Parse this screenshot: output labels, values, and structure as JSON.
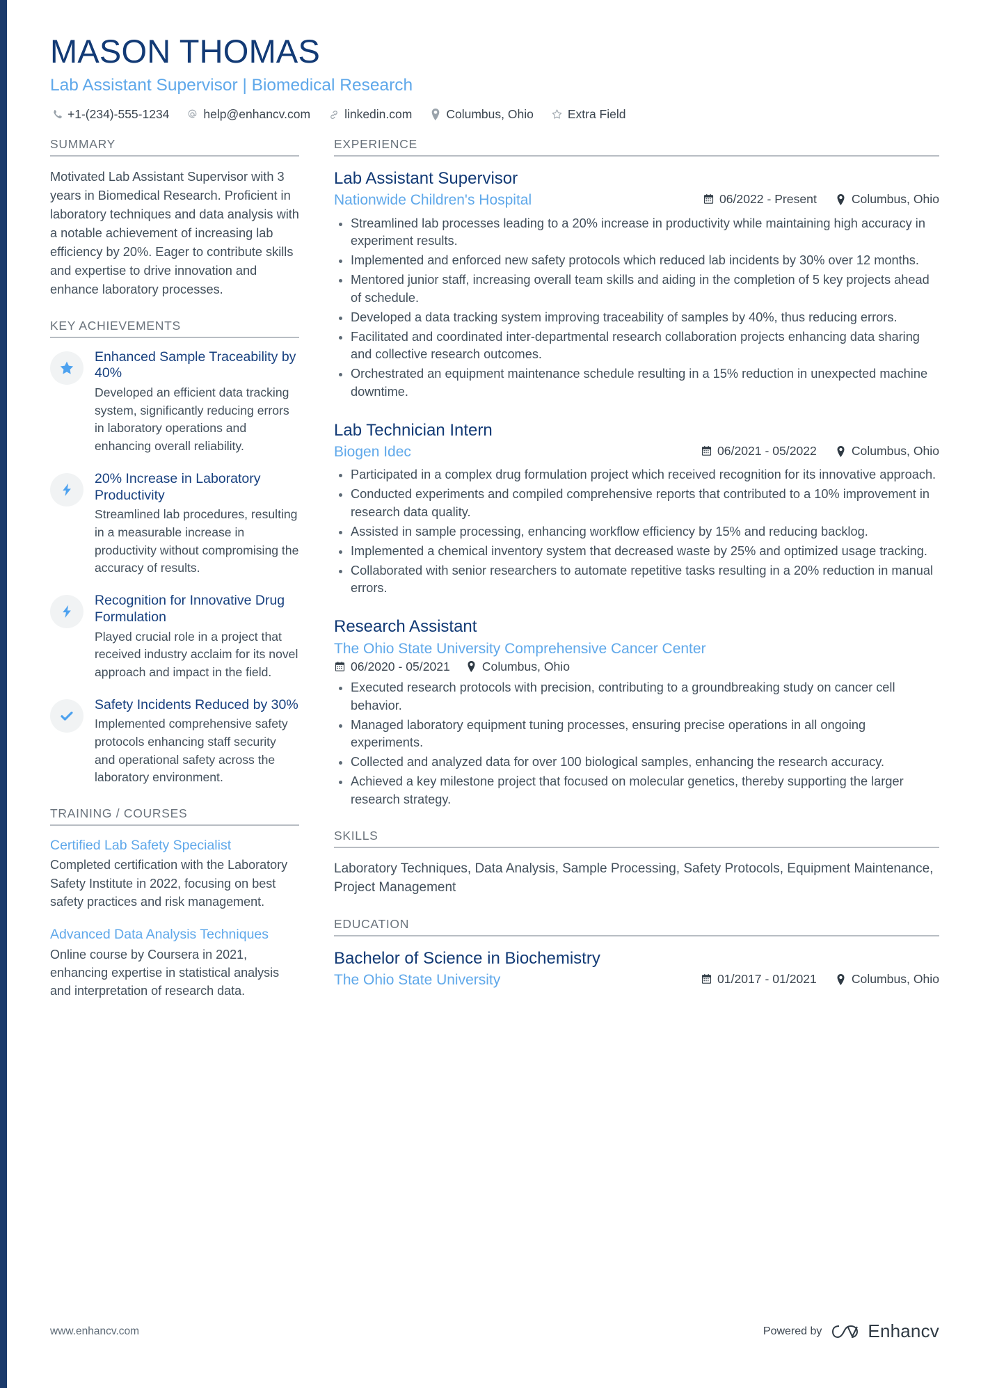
{
  "header": {
    "name": "MASON THOMAS",
    "headline": "Lab Assistant Supervisor | Biomedical Research",
    "contacts": [
      {
        "icon": "phone-icon",
        "text": "+1-(234)-555-1234"
      },
      {
        "icon": "email-icon",
        "text": "help@enhancv.com"
      },
      {
        "icon": "link-icon",
        "text": "linkedin.com"
      },
      {
        "icon": "location-pin-icon",
        "text": "Columbus, Ohio"
      },
      {
        "icon": "star-outline-icon",
        "text": "Extra Field"
      }
    ]
  },
  "colors": {
    "name_navy": "#123a75",
    "accent_blue": "#5fa8ea",
    "icon_blue": "#4ea2ef",
    "body_text": "#43505c",
    "section_label": "#6a737c",
    "rule": "#b8bdc3",
    "sidebar_bar": "#1a3a6b"
  },
  "summary": {
    "title": "SUMMARY",
    "text": "Motivated Lab Assistant Supervisor with 3 years in Biomedical Research. Proficient in laboratory techniques and data analysis with a notable achievement of increasing lab efficiency by 20%. Eager to contribute skills and expertise to drive innovation and enhance laboratory processes."
  },
  "key_achievements": {
    "title": "KEY ACHIEVEMENTS",
    "items": [
      {
        "icon": "star-icon",
        "title": "Enhanced Sample Traceability by 40%",
        "description": "Developed an efficient data tracking system, significantly reducing errors in laboratory operations and enhancing overall reliability."
      },
      {
        "icon": "lightning-bolt-icon",
        "title": "20% Increase in Laboratory Productivity",
        "description": "Streamlined lab procedures, resulting in a measurable increase in productivity without compromising the accuracy of results."
      },
      {
        "icon": "lightning-bolt-icon",
        "title": "Recognition for Innovative Drug Formulation",
        "description": "Played crucial role in a project that received industry acclaim for its novel approach and impact in the field."
      },
      {
        "icon": "check-icon",
        "title": "Safety Incidents Reduced by 30%",
        "description": "Implemented comprehensive safety protocols enhancing staff security and operational safety across the laboratory environment."
      }
    ]
  },
  "training": {
    "title": "TRAINING / COURSES",
    "items": [
      {
        "title": "Certified Lab Safety Specialist",
        "description": "Completed certification with the Laboratory Safety Institute in 2022, focusing on best safety practices and risk management."
      },
      {
        "title": "Advanced Data Analysis Techniques",
        "description": "Online course by Coursera in 2021, enhancing expertise in statistical analysis and interpretation of research data."
      }
    ]
  },
  "experience": {
    "title": "EXPERIENCE",
    "jobs": [
      {
        "title": "Lab Assistant Supervisor",
        "company": "Nationwide Children's Hospital",
        "dates": "06/2022 - Present",
        "location": "Columbus, Ohio",
        "bullets": [
          "Streamlined lab processes leading to a 20% increase in productivity while maintaining high accuracy in experiment results.",
          "Implemented and enforced new safety protocols which reduced lab incidents by 30% over 12 months.",
          "Mentored junior staff, increasing overall team skills and aiding in the completion of 5 key projects ahead of schedule.",
          "Developed a data tracking system improving traceability of samples by 40%, thus reducing errors.",
          "Facilitated and coordinated inter-departmental research collaboration projects enhancing data sharing and collective research outcomes.",
          "Orchestrated an equipment maintenance schedule resulting in a 15% reduction in unexpected machine downtime."
        ]
      },
      {
        "title": "Lab Technician Intern",
        "company": "Biogen Idec",
        "dates": "06/2021 - 05/2022",
        "location": "Columbus, Ohio",
        "bullets": [
          "Participated in a complex drug formulation project which received recognition for its innovative approach.",
          "Conducted experiments and compiled comprehensive reports that contributed to a 10% improvement in research data quality.",
          "Assisted in sample processing, enhancing workflow efficiency by 15% and reducing backlog.",
          "Implemented a chemical inventory system that decreased waste by 25% and optimized usage tracking.",
          "Collaborated with senior researchers to automate repetitive tasks resulting in a 20% reduction in manual errors."
        ]
      },
      {
        "title": "Research Assistant",
        "company": "The Ohio State University Comprehensive Cancer Center",
        "dates": "06/2020 - 05/2021",
        "location": "Columbus, Ohio",
        "bullets": [
          "Executed research protocols with precision, contributing to a groundbreaking study on cancer cell behavior.",
          "Managed laboratory equipment tuning processes, ensuring precise operations in all ongoing experiments.",
          "Collected and analyzed data for over 100 biological samples, enhancing the research accuracy.",
          "Achieved a key milestone project that focused on molecular genetics, thereby supporting the larger research strategy."
        ]
      }
    ]
  },
  "skills": {
    "title": "SKILLS",
    "text": "Laboratory Techniques, Data Analysis, Sample Processing, Safety Protocols, Equipment Maintenance, Project Management"
  },
  "education": {
    "title": "EDUCATION",
    "entries": [
      {
        "degree": "Bachelor of Science in Biochemistry",
        "school": "The Ohio State University",
        "dates": "01/2017 - 01/2021",
        "location": "Columbus, Ohio"
      }
    ]
  },
  "footer": {
    "url": "www.enhancv.com",
    "powered_by": "Powered by",
    "brand": "Enhancv"
  }
}
